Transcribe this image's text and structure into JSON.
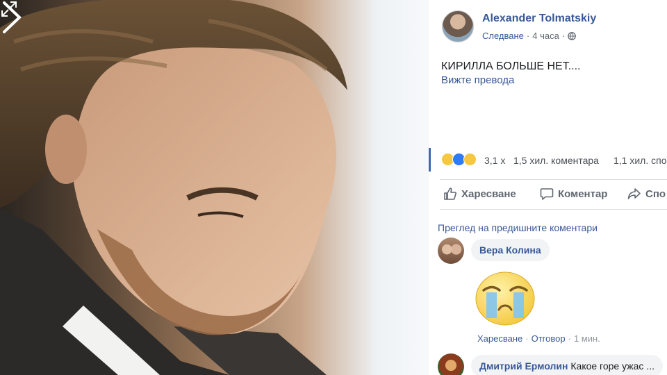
{
  "post": {
    "author": "Alexander Tolmatskiy",
    "follow_label": "Следване",
    "separator": "·",
    "time": "4 часа",
    "text": "КИРИЛЛА БОЛЬШЕ НЕТ....",
    "translate_link": "Вижте превода"
  },
  "stats": {
    "reactions": "3,1 х",
    "comments": "1,5 хил. коментара",
    "shares": "1,1 хил. спо"
  },
  "actions": {
    "like": "Харесване",
    "comment": "Коментар",
    "share": "Спо"
  },
  "comments": {
    "prev_link": "Преглед на предишните коментари",
    "items": [
      {
        "name": "Вера Колина",
        "text": "",
        "like": "Харесване",
        "reply": "Отговор",
        "time": "1 мин."
      },
      {
        "name": "Дмитрий Ермолин",
        "text": "Какое горе ужас ..."
      }
    ]
  },
  "icons": {
    "expand": "expand-icon",
    "next": "chevron-right-icon",
    "globe": "globe-icon",
    "like": "thumbs-up-icon",
    "comment": "comment-bubble-icon",
    "share": "share-arrow-icon",
    "sticker": "crying-face-sticker"
  },
  "colors": {
    "link_blue": "#385898",
    "accent_blue": "#4267b2",
    "muted": "#606770",
    "bubble_bg": "#f2f3f5"
  }
}
